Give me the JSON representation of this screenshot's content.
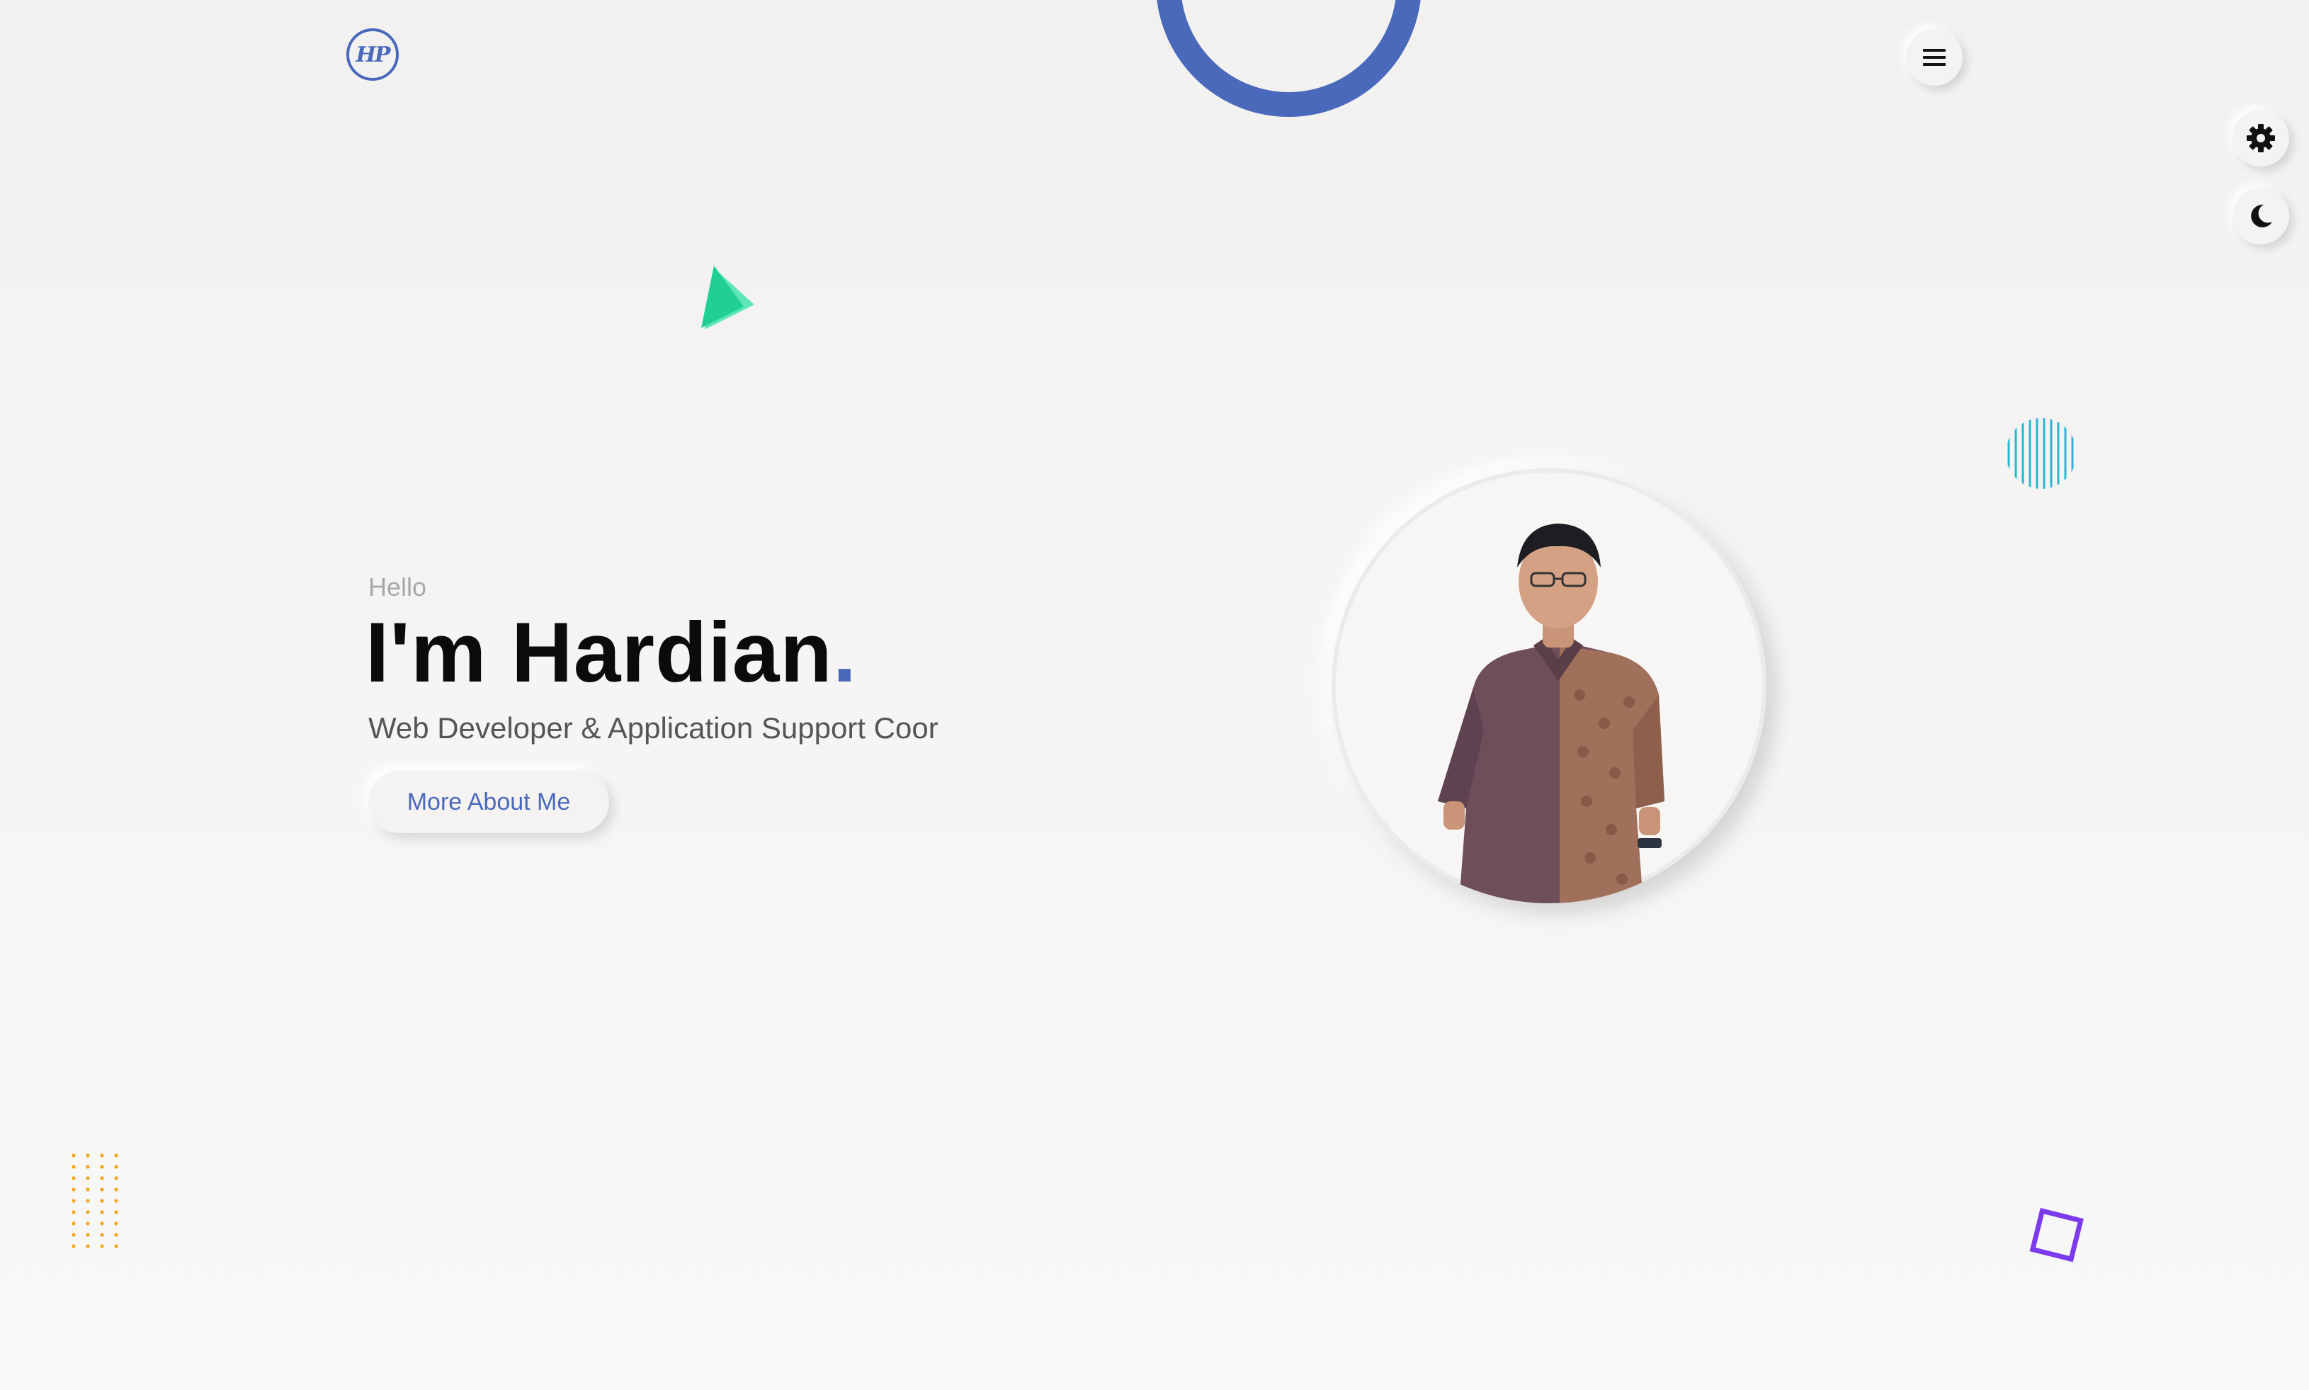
{
  "header": {
    "logo_text": "HP",
    "menu_icon": "hamburger-menu-icon"
  },
  "side_controls": {
    "settings_icon": "gear-icon",
    "theme_icon": "moon-icon"
  },
  "hero": {
    "greeting": "Hello",
    "heading": "I'm Hardian",
    "heading_dot": ".",
    "role": "Web Developer & Application Support Coor",
    "cta_label": "More About Me"
  },
  "colors": {
    "accent": "#4a69bb",
    "triangle": "#2ed8a3",
    "stripes": "#2bb5d3",
    "dots": "#f5a623",
    "square": "#7c3aed",
    "background": "#f3f2f1"
  }
}
